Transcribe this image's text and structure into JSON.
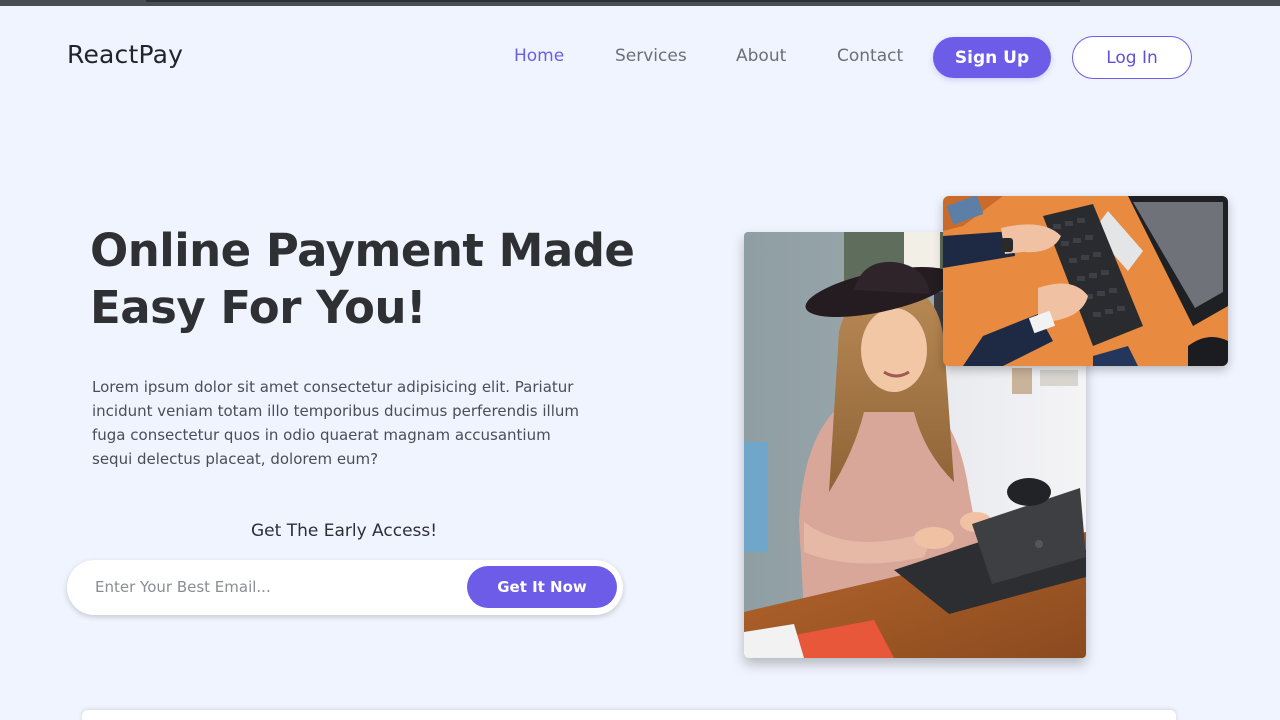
{
  "brand": {
    "name": "ReactPay"
  },
  "nav": {
    "items": [
      {
        "label": "Home",
        "active": true
      },
      {
        "label": "Services",
        "active": false
      },
      {
        "label": "About",
        "active": false
      },
      {
        "label": "Contact",
        "active": false
      }
    ],
    "signup_label": "Sign Up",
    "login_label": "Log In"
  },
  "hero": {
    "title_line1": "Online Payment Made",
    "title_line2": "Easy For You!",
    "description": "Lorem ipsum dolor sit amet consectetur adipisicing elit. Pariatur incidunt veniam totam illo temporibus ducimus perferendis illum fuga consectetur quos in odio quaerat magnam accusantium sequi delectus placeat, dolorem eum?",
    "early_access": "Get The Early Access!",
    "email_placeholder": "Enter Your Best Email...",
    "email_value": "",
    "cta_label": "Get It Now"
  },
  "images": {
    "woman_photo": "woman-with-laptop-photo",
    "keyboard_photo": "typing-on-keyboard-photo"
  },
  "colors": {
    "accent": "#6c5ce7",
    "background": "#f0f4fe",
    "heading": "#2f3033"
  }
}
